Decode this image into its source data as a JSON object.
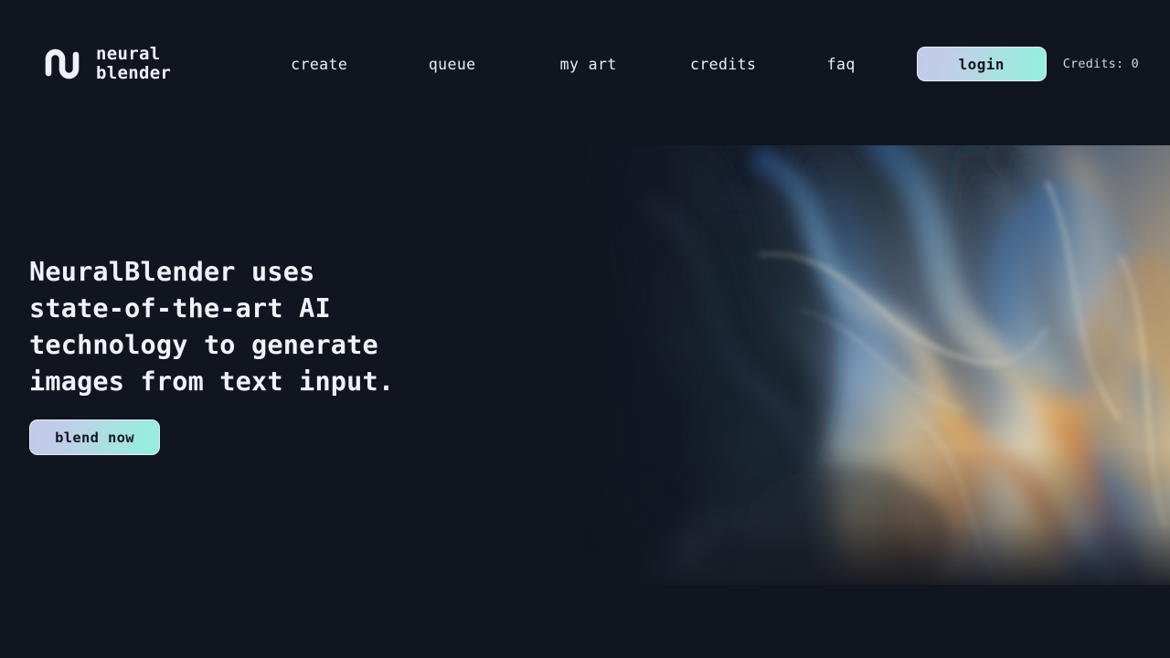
{
  "brand": {
    "icon": "neural-blender-monogram-icon",
    "line1": "neural",
    "line2": "blender",
    "full_text": "neural\nblender"
  },
  "nav": {
    "items": [
      {
        "id": "create",
        "label": "create"
      },
      {
        "id": "queue",
        "label": "queue"
      },
      {
        "id": "my-art",
        "label": "my art"
      },
      {
        "id": "credits",
        "label": "credits"
      },
      {
        "id": "faq",
        "label": "faq"
      }
    ]
  },
  "header_actions": {
    "login_label": "login",
    "credits_text": "Credits: 0",
    "credits_count": 0
  },
  "hero": {
    "headline": "NeuralBlender uses\nstate-of-the-art AI\ntechnology to generate\nimages from text input.",
    "cta_label": "blend now",
    "image_alt": "abstract iridescent holographic fluid artwork"
  },
  "colors": {
    "background": "#11151f",
    "text_primary": "#f0f2f7",
    "text_muted": "#cdd6e8",
    "gradient_start": "#c3c9e9",
    "gradient_end": "#93f0dd",
    "button_text": "#14161d",
    "button_border": "#e6eaf2"
  }
}
